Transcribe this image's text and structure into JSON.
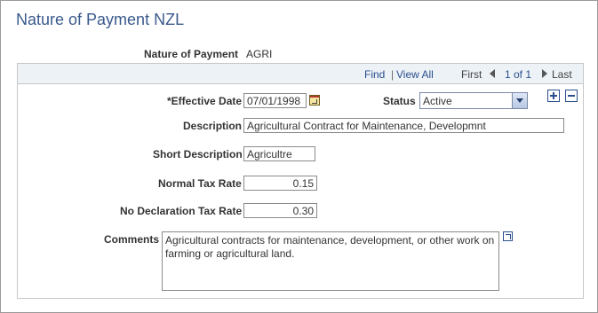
{
  "page": {
    "title": "Nature of Payment NZL"
  },
  "key": {
    "label": "Nature of Payment",
    "value": "AGRI"
  },
  "nav": {
    "find": "Find",
    "separator": "|",
    "view_all": "View All",
    "first": "First",
    "range": "1 of 1",
    "last": "Last"
  },
  "form": {
    "effective_date": {
      "label": "*Effective Date",
      "value": "07/01/1998",
      "icon": "calendar-icon"
    },
    "status": {
      "label": "Status",
      "value": "Active"
    },
    "description": {
      "label": "Description",
      "value": "Agricultural Contract for Maintenance, Developmnt"
    },
    "short_description": {
      "label": "Short Description",
      "value": "Agricultre"
    },
    "normal_tax_rate": {
      "label": "Normal Tax Rate",
      "value": "0.15"
    },
    "no_declaration_tax_rate": {
      "label": "No Declaration Tax Rate",
      "value": "0.30"
    },
    "comments": {
      "label": "Comments",
      "value": "Agricultural contracts for maintenance, development, or other work on farming or agricultural land.",
      "icon": "expand-icon"
    }
  },
  "icons": {
    "add_row": "plus-icon",
    "delete_row": "minus-icon"
  },
  "colors": {
    "title": "#3a5a8c",
    "link": "#2a4f8c",
    "header_bar": "#edf2f7"
  }
}
